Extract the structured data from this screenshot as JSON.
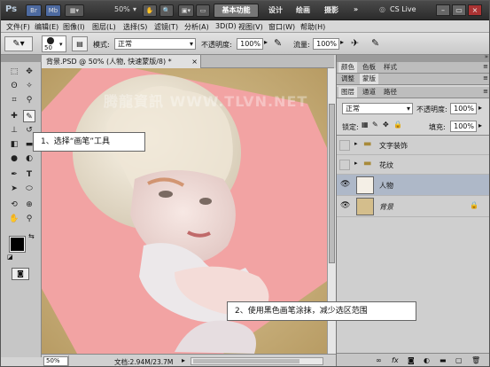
{
  "titlebar": {
    "logo": "Ps",
    "br": "Br",
    "mb": "Mb",
    "zoom": "50%",
    "workspaces": [
      "基本功能",
      "设计",
      "绘画",
      "摄影"
    ],
    "more": "»",
    "cslive": "CS Live"
  },
  "menu": [
    "文件(F)",
    "编辑(E)",
    "图像(I)",
    "图层(L)",
    "选择(S)",
    "滤镜(T)",
    "分析(A)",
    "3D(D)",
    "视图(V)",
    "窗口(W)",
    "帮助(H)"
  ],
  "options": {
    "brush_size": "50",
    "mode_label": "模式:",
    "mode_value": "正常",
    "opacity_label": "不透明度:",
    "opacity_value": "100%",
    "flow_label": "流量:",
    "flow_value": "100%"
  },
  "document": {
    "tab_title": "背景.PSD @ 50% (人物, 快速蒙版/8) *",
    "close": "×",
    "zoom": "50%",
    "doc_info": "文档:2.94M/23.7M"
  },
  "watermark": "腾龍資訊 WWW.TLVN.NET",
  "callouts": {
    "step1": "1、选择“画笔”工具",
    "step2": "2、使用黑色画笔涂抹，减少选区范围"
  },
  "panels": {
    "top_tabs": [
      "颜色",
      "色板",
      "样式"
    ],
    "mid_tabs": [
      "调整",
      "蒙版"
    ],
    "layer_tabs": [
      "图层",
      "通道",
      "路径"
    ],
    "blend_mode": "正常",
    "opacity_label": "不透明度:",
    "opacity_value": "100%",
    "lock_label": "锁定:",
    "fill_label": "填充:",
    "fill_value": "100%",
    "layers": [
      {
        "name": "文字装饰",
        "type": "group"
      },
      {
        "name": "花纹",
        "type": "group"
      },
      {
        "name": "人物",
        "type": "layer"
      },
      {
        "name": "背景",
        "type": "background"
      }
    ]
  }
}
